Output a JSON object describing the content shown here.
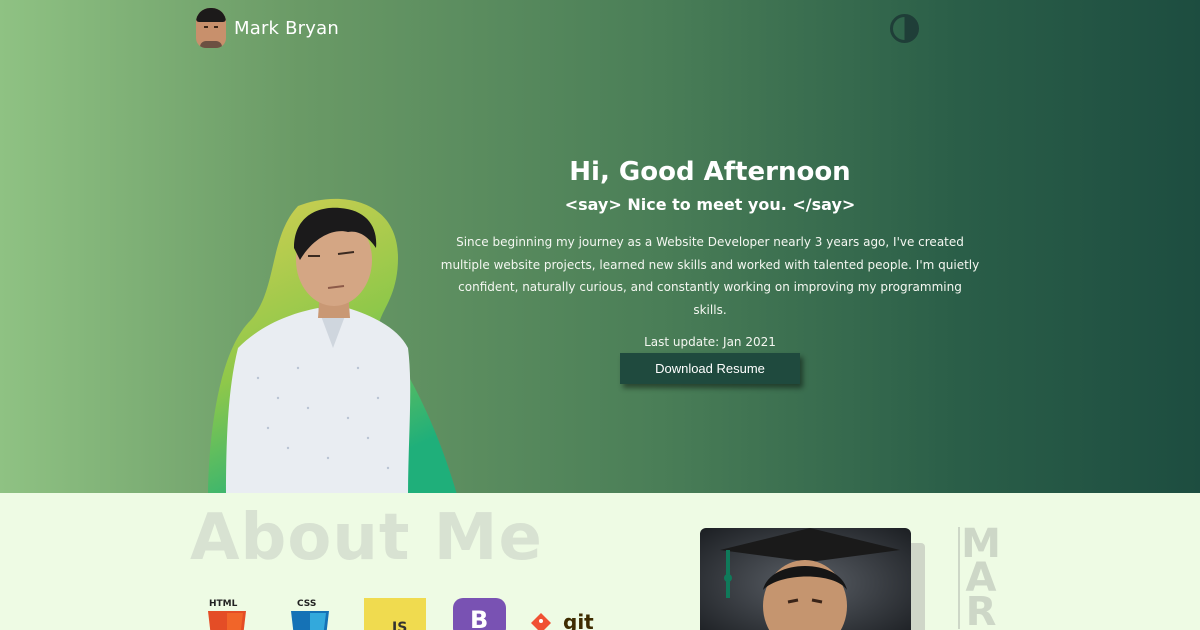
{
  "brand": {
    "name": "Mark Bryan"
  },
  "header": {
    "theme_toggle": "contrast-icon"
  },
  "hero": {
    "greeting": "Hi, Good Afternoon",
    "tagline": "<say> Nice to meet you. </say>",
    "bio": "Since beginning my journey as a Website Developer nearly 3 years ago, I've created multiple website projects, learned new skills and worked with talented people. I'm quietly confident, naturally curious, and constantly working on improving my programming skills.",
    "last_update": "Last update: Jan 2021",
    "download_label": "Download Resume"
  },
  "about": {
    "title": "About Me",
    "side_letters": [
      "M",
      "A",
      "R"
    ],
    "skills": [
      {
        "name": "HTML",
        "icon": "html5-icon",
        "color": "#e44d26"
      },
      {
        "name": "CSS",
        "icon": "css3-icon",
        "color": "#1572b6"
      },
      {
        "name": "JS",
        "icon": "javascript-icon",
        "color": "#f0db4f"
      },
      {
        "name": "B",
        "icon": "bootstrap-icon",
        "color": "#7952b3"
      },
      {
        "name": "git",
        "icon": "git-icon",
        "color": "#f05133"
      }
    ]
  },
  "colors": {
    "hero_start": "#8fc283",
    "hero_end": "#1d4d40",
    "button": "#1f4a3e",
    "page_bg": "#eefbe4"
  }
}
